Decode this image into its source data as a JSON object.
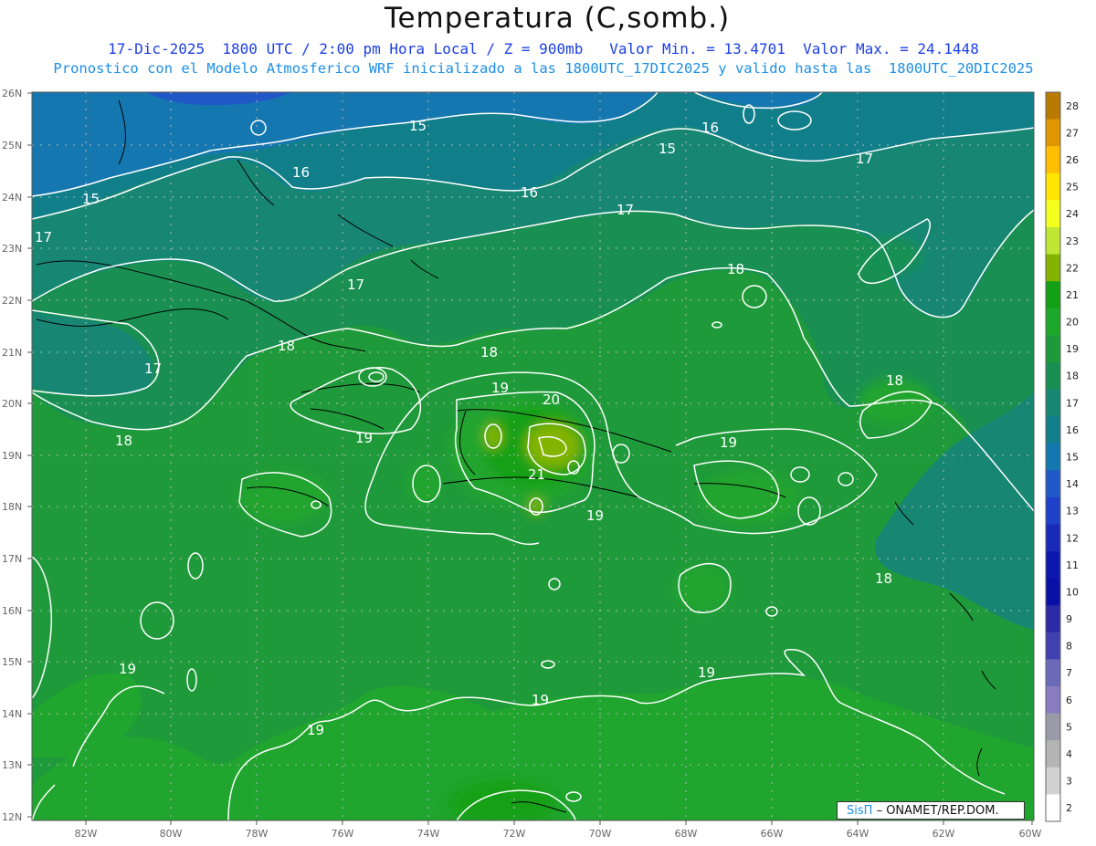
{
  "header": {
    "title": "Temperatura (C,somb.)",
    "subtitle_line1": "17-Dic-2025  1800 UTC / 2:00 pm Hora Local / Z = 900mb   Valor Min. = 13.4701  Valor Max. = 24.1448",
    "subtitle_line2": "Pronostico con el Modelo Atmosferico WRF inicializado a las 1800UTC_17DIC2025 y valido hasta las  1800UTC_20DIC2025"
  },
  "axes": {
    "lon_labels": [
      "82W",
      "80W",
      "78W",
      "76W",
      "74W",
      "72W",
      "70W",
      "68W",
      "66W",
      "64W",
      "62W",
      "60W"
    ],
    "lat_labels": [
      "26N",
      "25N",
      "24N",
      "23N",
      "22N",
      "21N",
      "20N",
      "19N",
      "18N",
      "17N",
      "16N",
      "15N",
      "14N",
      "13N",
      "12N"
    ]
  },
  "colorbar": {
    "values": [
      "28",
      "27",
      "26",
      "25",
      "24",
      "23",
      "22",
      "21",
      "20",
      "19",
      "18",
      "17",
      "16",
      "15",
      "14",
      "13",
      "12",
      "11",
      "10",
      "9",
      "8",
      "7",
      "6",
      "5",
      "4",
      "3",
      "2"
    ],
    "colors": [
      "#b97a00",
      "#e09600",
      "#ffbe00",
      "#ffe600",
      "#f4ff1e",
      "#bfe632",
      "#82b400",
      "#14a014",
      "#1ea82a",
      "#1f9a3a",
      "#199052",
      "#178774",
      "#117f8a",
      "#1577b0",
      "#2158c8",
      "#1f40c8",
      "#1a2ab8",
      "#0c17b0",
      "#0a10a6",
      "#2a2aa6",
      "#4040b0",
      "#6a6ab8",
      "#8a7cc0",
      "#9a9aa8",
      "#b4b4b4",
      "#d2d2d2",
      "#ffffff"
    ]
  },
  "contour_labels": [
    "15",
    "15",
    "15",
    "16",
    "16",
    "16",
    "17",
    "17",
    "17",
    "17",
    "17",
    "17",
    "18",
    "18",
    "18",
    "18",
    "18",
    "18",
    "19",
    "19",
    "19",
    "19",
    "19",
    "19",
    "19",
    "19",
    "20",
    "21"
  ],
  "credit": {
    "sis": "SisΠ",
    "org": "– ONAMET/REP.DOM."
  }
}
